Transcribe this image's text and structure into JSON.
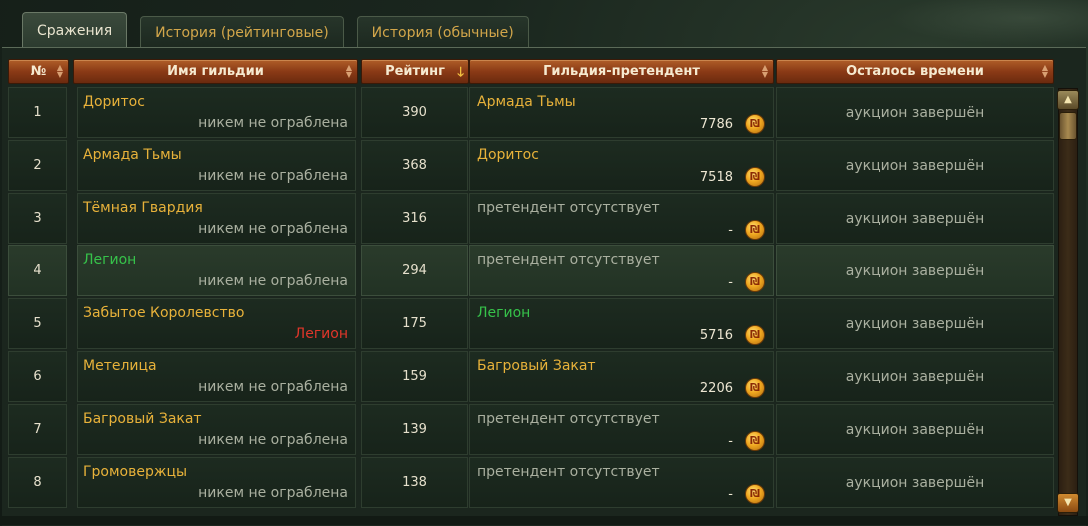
{
  "tabs": [
    {
      "label": "Сражения",
      "active": true
    },
    {
      "label": "История (рейтинговые)",
      "active": false
    },
    {
      "label": "История (обычные)",
      "active": false
    }
  ],
  "columns": {
    "num": "№",
    "guild": "Имя гильдии",
    "rating": "Рейтинг",
    "contender": "Гильдия-претендент",
    "time": "Осталось времени"
  },
  "sort": {
    "column": "rating",
    "direction": "desc"
  },
  "colors": {
    "guild": "#e8b23a",
    "allied": "#36c24a",
    "enemy": "#e0362a",
    "muted": "#aab0a0"
  },
  "rows": [
    {
      "num": "1",
      "guild": "Доритос",
      "guild_color": "guild",
      "sub": "никем не ограблена",
      "sub_color": "muted",
      "rating": "390",
      "contender": "Армада Тьмы",
      "contender_color": "guild",
      "bid": "7786",
      "time": "аукцион завершён",
      "highlight": false
    },
    {
      "num": "2",
      "guild": "Армада Тьмы",
      "guild_color": "guild",
      "sub": "никем не ограблена",
      "sub_color": "muted",
      "rating": "368",
      "contender": "Доритос",
      "contender_color": "guild",
      "bid": "7518",
      "time": "аукцион завершён",
      "highlight": false
    },
    {
      "num": "3",
      "guild": "Тёмная Гвардия",
      "guild_color": "guild",
      "sub": "никем не ограблена",
      "sub_color": "muted",
      "rating": "316",
      "contender": "претендент отсутствует",
      "contender_color": "muted",
      "bid": "-",
      "time": "аукцион завершён",
      "highlight": false
    },
    {
      "num": "4",
      "guild": "Легион",
      "guild_color": "allied",
      "sub": "никем не ограблена",
      "sub_color": "muted",
      "rating": "294",
      "contender": "претендент отсутствует",
      "contender_color": "muted",
      "bid": "-",
      "time": "аукцион завершён",
      "highlight": true
    },
    {
      "num": "5",
      "guild": "Забытое Королевство",
      "guild_color": "guild",
      "sub": "Легион",
      "sub_color": "enemy",
      "rating": "175",
      "contender": "Легион",
      "contender_color": "allied",
      "bid": "5716",
      "time": "аукцион завершён",
      "highlight": false
    },
    {
      "num": "6",
      "guild": "Метелица",
      "guild_color": "guild",
      "sub": "никем не ограблена",
      "sub_color": "muted",
      "rating": "159",
      "contender": "Багровый Закат",
      "contender_color": "guild",
      "bid": "2206",
      "time": "аукцион завершён",
      "highlight": false
    },
    {
      "num": "7",
      "guild": "Багровый Закат",
      "guild_color": "guild",
      "sub": "никем не ограблена",
      "sub_color": "muted",
      "rating": "139",
      "contender": "претендент отсутствует",
      "contender_color": "muted",
      "bid": "-",
      "time": "аукцион завершён",
      "highlight": false
    },
    {
      "num": "8",
      "guild": "Громовержцы",
      "guild_color": "guild",
      "sub": "никем не ограблена",
      "sub_color": "muted",
      "rating": "138",
      "contender": "претендент отсутствует",
      "contender_color": "muted",
      "bid": "-",
      "time": "аукцион завершён",
      "highlight": false
    }
  ],
  "icons": {
    "coin": "gold-coin-icon",
    "sort": "sort-desc-arrow-icon",
    "scroll_up": "scroll-up-icon",
    "scroll_down": "scroll-down-icon"
  }
}
